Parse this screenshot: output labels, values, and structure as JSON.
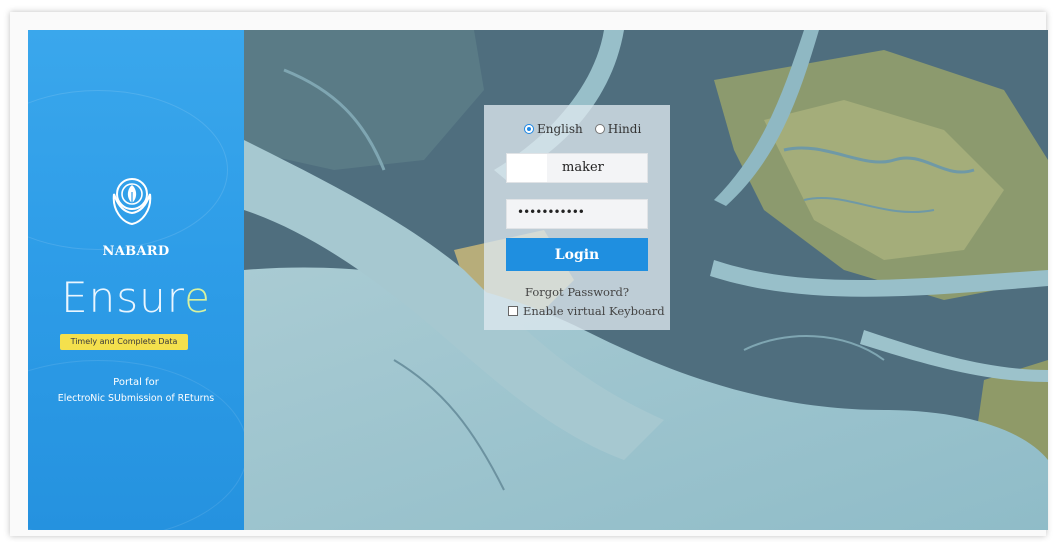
{
  "brand": {
    "org_name": "NABARD",
    "product_name_main": "Ensur",
    "product_name_accent": "e",
    "tagline": "Timely and Complete Data",
    "portal_for": "Portal for",
    "portal_description": "ElectroNic SUbmission of REturns",
    "panel_color": "#2e9de8",
    "tagline_color": "#f4e04d"
  },
  "login": {
    "languages": [
      {
        "label": "English",
        "selected": true
      },
      {
        "label": "Hindi",
        "selected": false
      }
    ],
    "username_value": "maker",
    "password_value": "•••••••••••",
    "login_label": "Login",
    "forgot_label": "Forgot Password?",
    "virtual_keyboard_label": "Enable virtual Keyboard",
    "virtual_keyboard_checked": false,
    "button_color": "#1f8fe0"
  },
  "icons": {
    "logo": "nabard-hands-logo-icon"
  }
}
